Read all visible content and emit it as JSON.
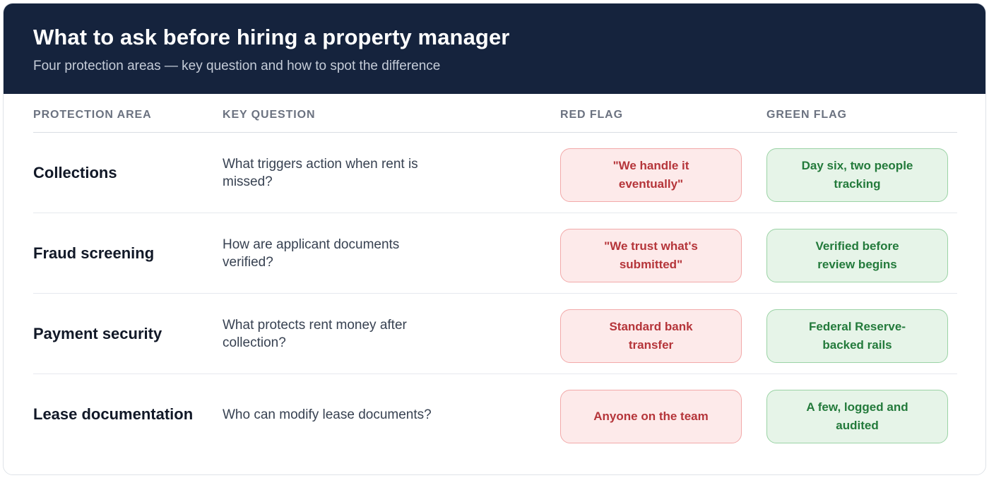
{
  "header": {
    "title": "What to ask before hiring a property manager",
    "subtitle": "Four protection areas — key question and how to spot the difference"
  },
  "columns": {
    "area": "PROTECTION AREA",
    "question": "KEY QUESTION",
    "red": "RED FLAG",
    "green": "GREEN FLAG"
  },
  "rows": [
    {
      "area": "Collections",
      "question": "What triggers action when rent is missed?",
      "red_flag": "\"We handle it eventually\"",
      "green_flag": "Day six, two people tracking"
    },
    {
      "area": "Fraud screening",
      "question": "How are applicant documents verified?",
      "red_flag": "\"We trust what's submitted\"",
      "green_flag": "Verified before review begins"
    },
    {
      "area": "Payment security",
      "question": "What protects rent money after collection?",
      "red_flag": "Standard bank transfer",
      "green_flag": "Federal Reserve-backed rails"
    },
    {
      "area": "Lease documentation",
      "question": "Who can modify lease documents?",
      "red_flag": "Anyone on the team",
      "green_flag": "A few, logged and audited"
    }
  ],
  "colors": {
    "header_bg": "#15233d",
    "red_text": "#b5353a",
    "red_bg": "#fdeaea",
    "green_text": "#237a3b",
    "green_bg": "#e6f4e8"
  }
}
